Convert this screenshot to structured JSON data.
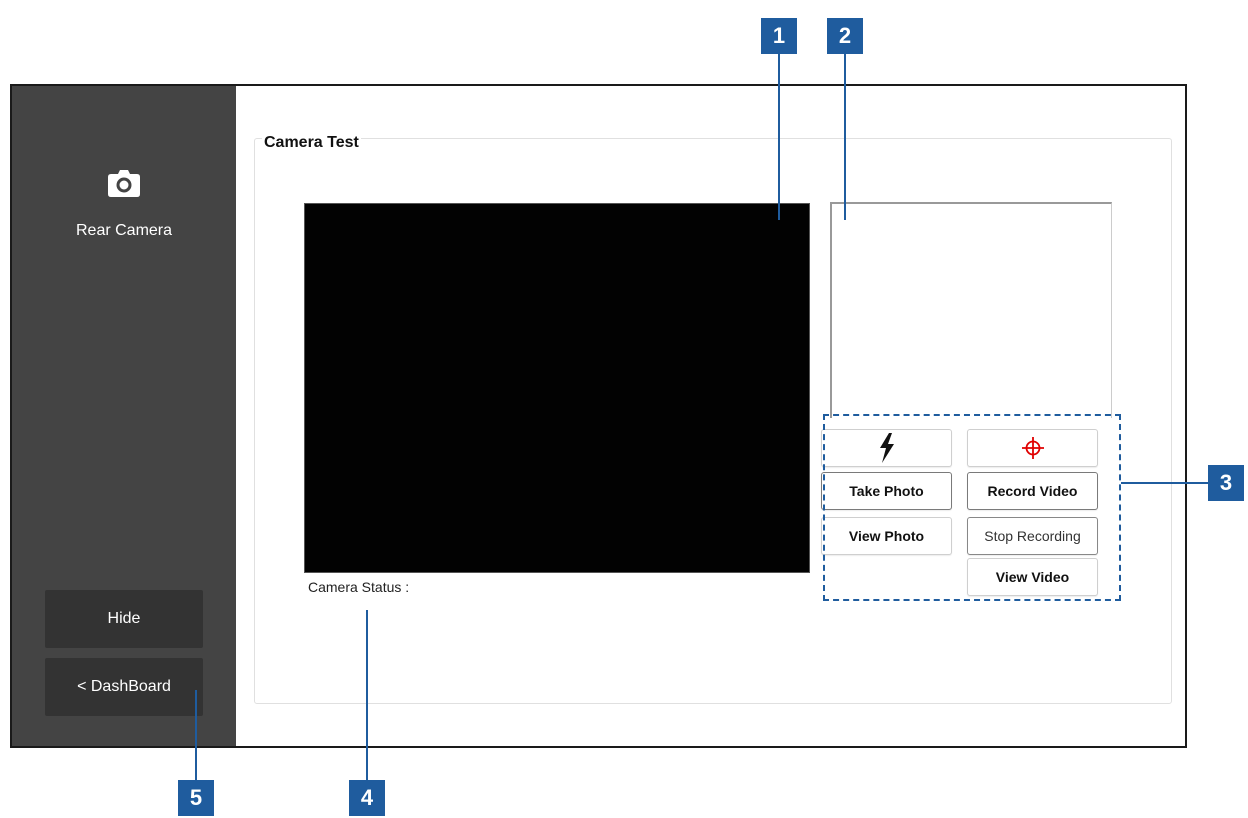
{
  "sidebar": {
    "camera_icon": "camera-icon",
    "label": "Rear Camera",
    "hide_label": "Hide",
    "dashboard_label": "< DashBoard"
  },
  "panel": {
    "title": "Camera Test",
    "status_label": "Camera Status :"
  },
  "controls": {
    "flash_icon": "flash-icon",
    "focus_icon": "crosshair-icon",
    "take_photo": "Take Photo",
    "record_video": "Record Video",
    "view_photo": "View Photo",
    "stop_recording": "Stop Recording",
    "view_video": "View Video"
  },
  "callouts": {
    "c1": "1",
    "c2": "2",
    "c3": "3",
    "c4": "4",
    "c5": "5"
  },
  "colors": {
    "sidebar_bg": "#444444",
    "sidebar_button_bg": "#333333",
    "callout_blue": "#1f5c9e",
    "crosshair_red": "#e00000"
  }
}
